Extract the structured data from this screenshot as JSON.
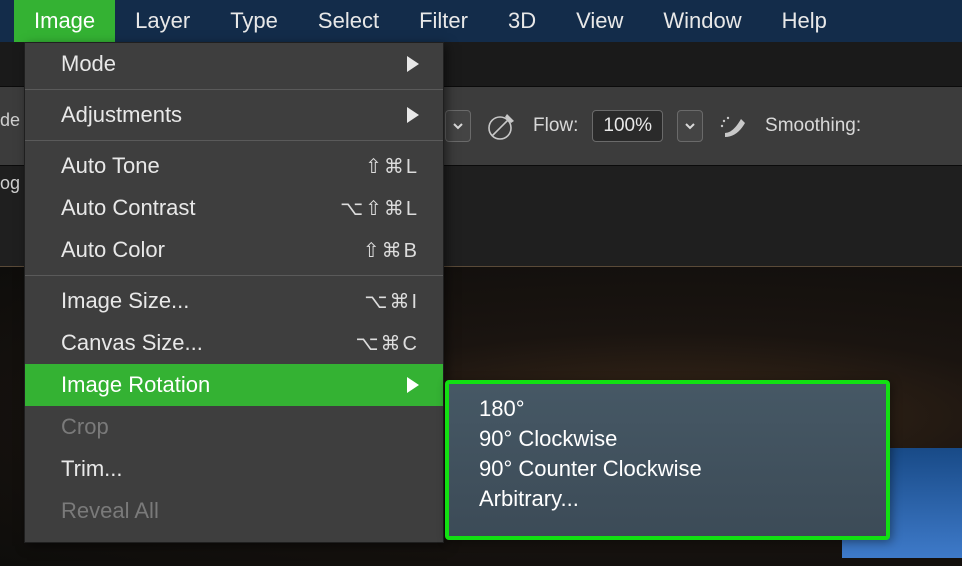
{
  "menubar": {
    "items": [
      {
        "label": "Image",
        "active": true
      },
      {
        "label": "Layer"
      },
      {
        "label": "Type"
      },
      {
        "label": "Select"
      },
      {
        "label": "Filter"
      },
      {
        "label": "3D"
      },
      {
        "label": "View"
      },
      {
        "label": "Window"
      },
      {
        "label": "Help"
      }
    ]
  },
  "left_edge": {
    "label_top": "de",
    "label_bottom": "og"
  },
  "toolbar": {
    "flow_label": "Flow:",
    "flow_value": "100%",
    "smoothing_label": "Smoothing:"
  },
  "dropdown": {
    "items": [
      {
        "label": "Mode",
        "submenu": true
      },
      {
        "sep": true
      },
      {
        "label": "Adjustments",
        "submenu": true
      },
      {
        "sep": true
      },
      {
        "label": "Auto Tone",
        "shortcut": "⇧⌘L"
      },
      {
        "label": "Auto Contrast",
        "shortcut": "⌥⇧⌘L"
      },
      {
        "label": "Auto Color",
        "shortcut": "⇧⌘B"
      },
      {
        "sep": true
      },
      {
        "label": "Image Size...",
        "shortcut": "⌥⌘I"
      },
      {
        "label": "Canvas Size...",
        "shortcut": "⌥⌘C"
      },
      {
        "label": "Image Rotation",
        "submenu": true,
        "highlighted": true
      },
      {
        "label": "Crop",
        "disabled": true
      },
      {
        "label": "Trim..."
      },
      {
        "label": "Reveal All",
        "disabled": true
      }
    ]
  },
  "submenu": {
    "items": [
      {
        "label": "180°"
      },
      {
        "label": "90° Clockwise"
      },
      {
        "label": "90° Counter Clockwise"
      },
      {
        "label": "Arbitrary..."
      }
    ]
  }
}
